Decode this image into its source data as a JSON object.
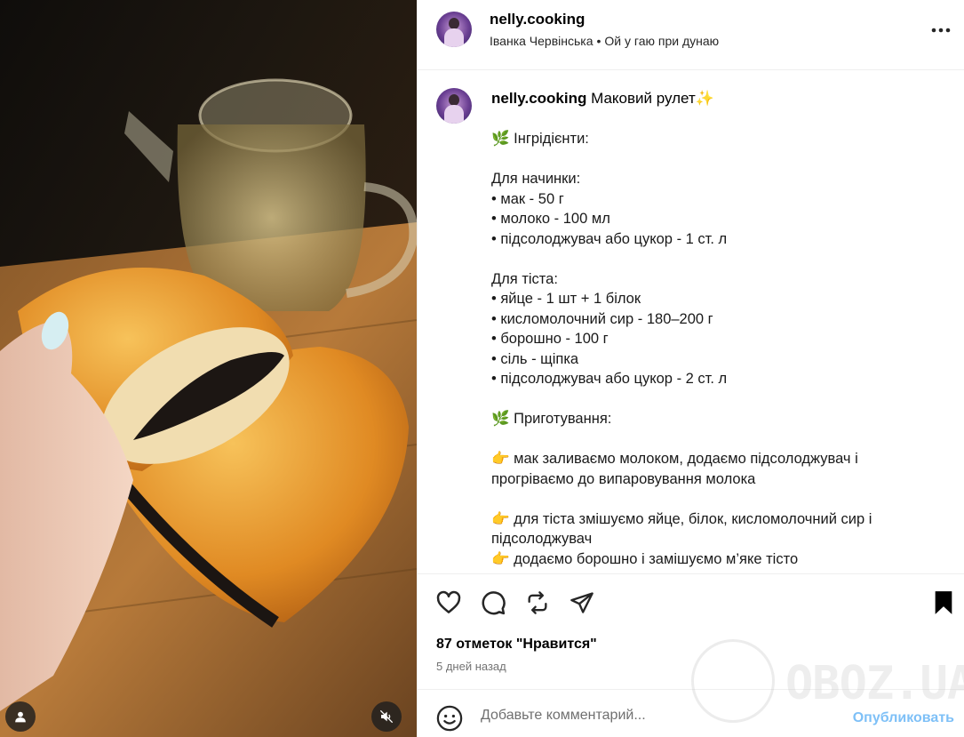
{
  "post": {
    "username": "nelly.cooking",
    "author_name": "Іванка Червінська",
    "separator": "•",
    "audio": "Ой у гаю при дунаю",
    "caption_title": "Маковий рулет✨",
    "caption_lines": [
      {
        "text": "🌿 Інгрідієнти:"
      },
      {
        "text": ""
      },
      {
        "text": "Для начинки:"
      },
      {
        "text": "• мак - 50 г"
      },
      {
        "text": "• молоко - 100 мл"
      },
      {
        "text": "• підсолоджувач або цукор - 1 ст. л"
      },
      {
        "text": ""
      },
      {
        "text": "Для тіста:"
      },
      {
        "text": "• яйце - 1 шт + 1 білок"
      },
      {
        "text": "• кисломолочний сир - 180–200 г"
      },
      {
        "text": "• борошно - 100 г"
      },
      {
        "text": "• сіль - щіпка"
      },
      {
        "text": "• підсолоджувач або цукор - 2 ст. л"
      },
      {
        "text": ""
      },
      {
        "text": "🌿 Приготування:"
      },
      {
        "text": ""
      },
      {
        "text": "👉 мак заливаємо молоком, додаємо підсолоджувач і прогріваємо до випаровування молока",
        "wrap": true
      },
      {
        "text": ""
      },
      {
        "text": "👉 для тіста змішуємо яйце, білок, кисломолочний сир і підсолоджувач",
        "wrap": true
      },
      {
        "text": "👉 додаємо борошно і замішуємо м’яке тісто"
      }
    ],
    "likes": "87 отметок \"Нравится\"",
    "time_ago": "5 дней назад"
  },
  "comment": {
    "placeholder": "Добавьте комментарий...",
    "post_label": "Опубликовать"
  },
  "icons": {
    "more": "more-horizontal-icon",
    "like": "heart-icon",
    "comment": "comment-bubble-icon",
    "repost": "repost-icon",
    "share": "send-icon",
    "save": "bookmark-icon",
    "emoji": "smile-icon",
    "user_tag": "user-icon",
    "mute": "mute-icon"
  },
  "colors": {
    "link_blue_disabled": "#7ec0f7",
    "text_secondary": "#737373"
  },
  "watermark": {
    "text": "OBOZ.UA"
  }
}
